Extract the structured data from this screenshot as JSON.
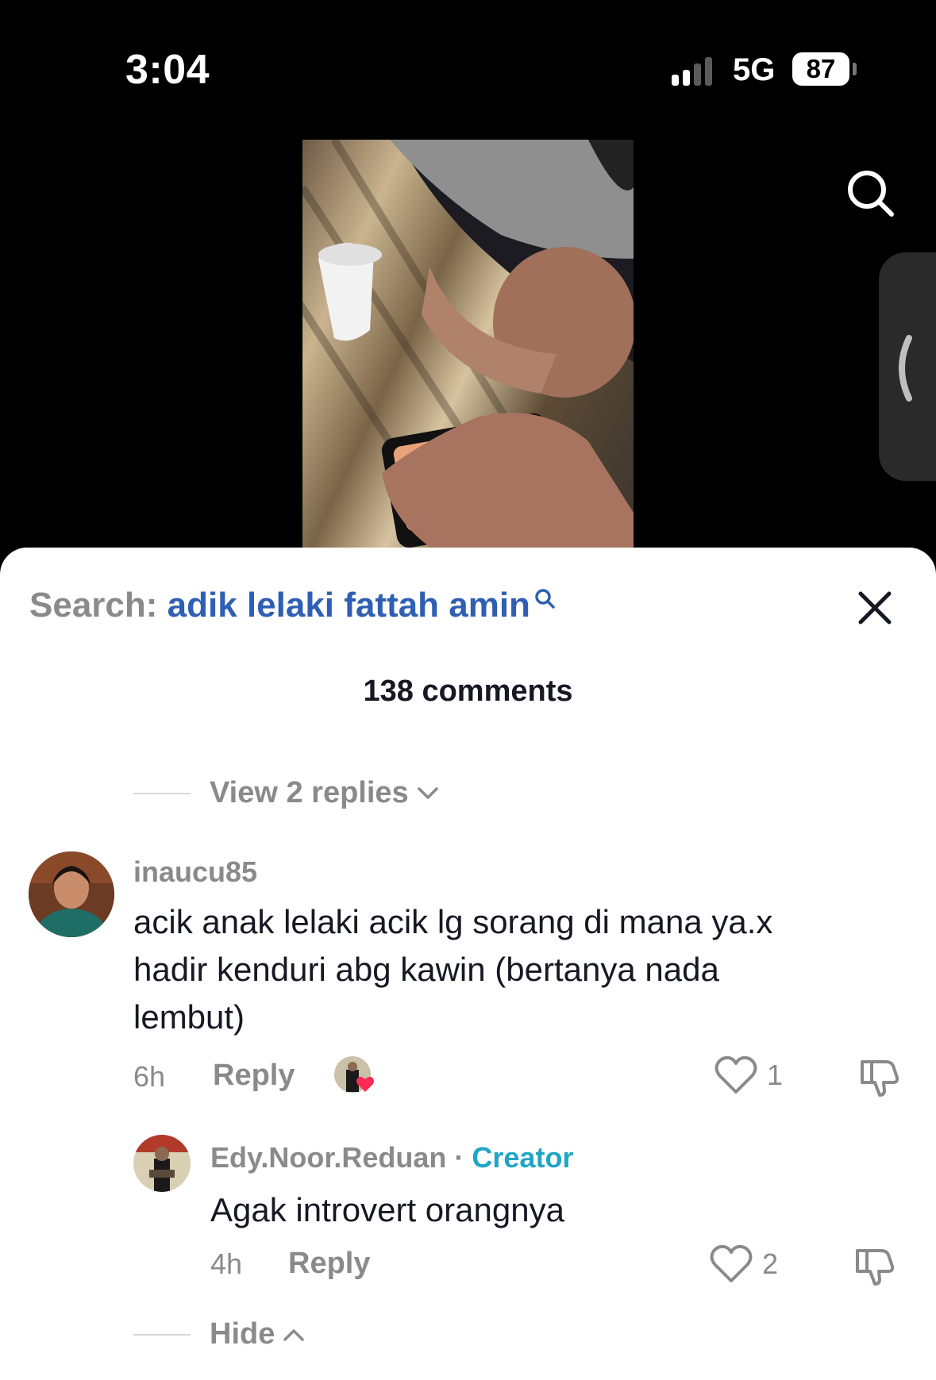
{
  "status_bar": {
    "time": "3:04",
    "network": "5G",
    "battery": "87"
  },
  "search": {
    "prefix": "Search:",
    "query": "adik lelaki fattah amin"
  },
  "comments_header": {
    "count_label": "138 comments"
  },
  "view_replies": {
    "label": "View 2 replies"
  },
  "comments": [
    {
      "username": "inaucu85",
      "text_lines": [
        "acik anak lelaki acik lg sorang di mana ya.x",
        "hadir kenduri abg kawin (bertanya nada",
        "lembut)"
      ],
      "time": "6h",
      "reply_label": "Reply",
      "likes": "1"
    },
    {
      "username": "Edy.Noor.Reduan",
      "separator": "·",
      "badge": "Creator",
      "text": "Agak introvert orangnya",
      "time": "4h",
      "reply_label": "Reply",
      "likes": "2"
    }
  ],
  "hide_replies": {
    "label": "Hide"
  },
  "colors": {
    "accent_blue": "#2f5fb3",
    "creator_teal": "#21a5c6",
    "liked_heart": "#fe2c55"
  },
  "icons": [
    "search-icon",
    "side-panel-chevron-icon",
    "close-icon",
    "chevron-down-icon",
    "heart-icon",
    "dislike-icon",
    "chevron-up-icon"
  ]
}
